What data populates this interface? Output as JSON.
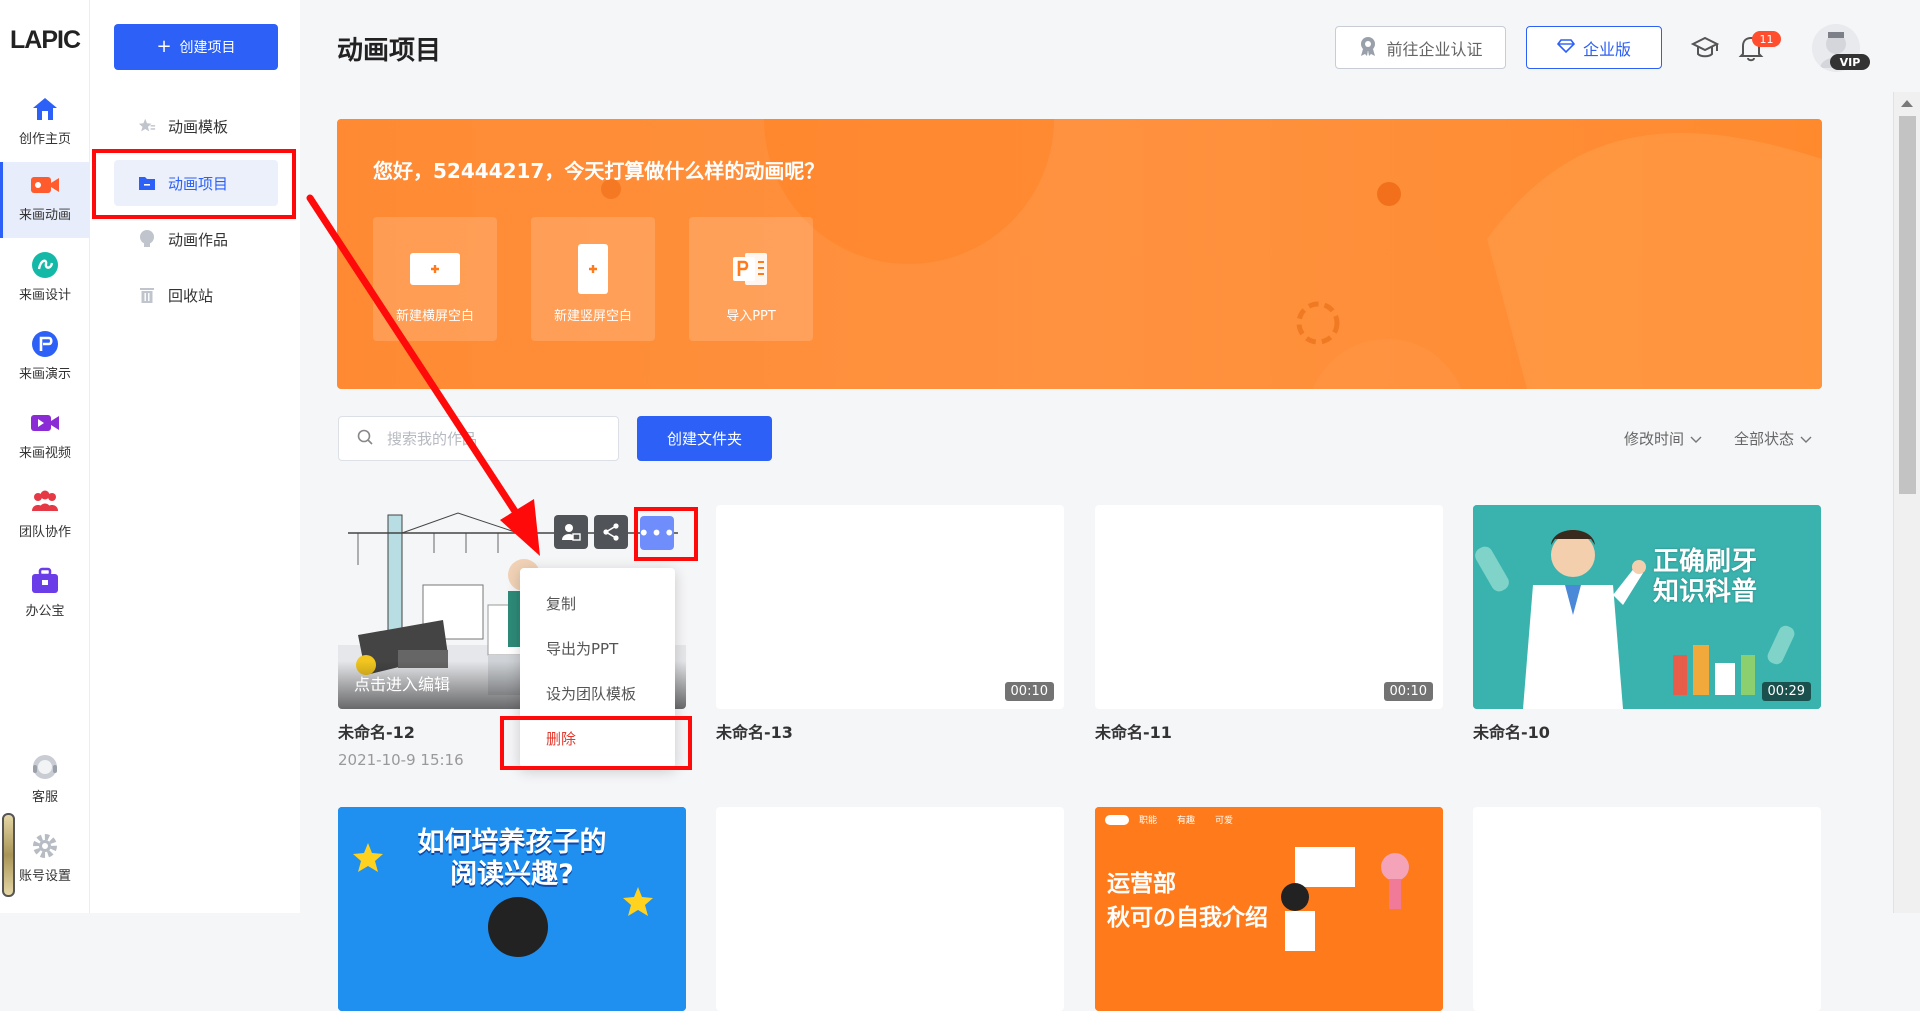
{
  "logo": "LAPIC",
  "rail": {
    "items": [
      {
        "label": "创作主页",
        "icon": "home-icon"
      },
      {
        "label": "来画动画",
        "icon": "video-camera-icon"
      },
      {
        "label": "来画设计",
        "icon": "design-icon"
      },
      {
        "label": "来画演示",
        "icon": "presentation-icon"
      },
      {
        "label": "来画视频",
        "icon": "video-icon"
      },
      {
        "label": "团队协作",
        "icon": "team-icon"
      },
      {
        "label": "办公宝",
        "icon": "briefcase-icon"
      }
    ],
    "bottom": [
      {
        "label": "客服",
        "icon": "headset-icon"
      },
      {
        "label": "账号设置",
        "icon": "gear-icon"
      }
    ]
  },
  "sidebar": {
    "create_label": "创建项目",
    "items": [
      {
        "label": "动画模板",
        "icon": "star-icon"
      },
      {
        "label": "动画项目",
        "icon": "folder-icon"
      },
      {
        "label": "动画作品",
        "icon": "bulb-icon"
      },
      {
        "label": "回收站",
        "icon": "trash-icon"
      }
    ]
  },
  "header": {
    "title": "动画项目",
    "cert_label": "前往企业认证",
    "enterprise_label": "企业版",
    "notification_count": "11",
    "vip_label": "VIP"
  },
  "banner": {
    "greeting": "您好，52444217，今天打算做什么样的动画呢？",
    "actions": [
      {
        "label": "新建横屏空白"
      },
      {
        "label": "新建竖屏空白"
      },
      {
        "label": "导入PPT"
      }
    ]
  },
  "toolbar": {
    "search_placeholder": "搜索我的作品",
    "create_folder_label": "创建文件夹",
    "sort_label": "修改时间",
    "status_label": "全部状态"
  },
  "projects": [
    {
      "title": "未命名-12",
      "date": "2021-10-9 15:16",
      "hover_text": "点击进入编辑"
    },
    {
      "title": "未命名-13",
      "duration": "00:10"
    },
    {
      "title": "未命名-11",
      "duration": "00:10"
    },
    {
      "title": "未命名-10",
      "duration": "00:29",
      "thumb_text_1": "正确刷牙",
      "thumb_text_2": "知识科普"
    }
  ],
  "projects_row2": [
    {
      "thumb_text_1": "如何培养孩子的",
      "thumb_text_2": "阅读兴趣?"
    },
    {},
    {
      "thumb_text_1": "运营部",
      "thumb_text_2": "秋可の自我介绍",
      "tags": [
        "职能",
        "有趣",
        "可爱"
      ]
    },
    {}
  ],
  "context_menu": {
    "items": [
      "复制",
      "导出为PPT",
      "设为团队模板",
      "删除"
    ]
  },
  "colors": {
    "primary": "#2c60f6",
    "banner": "#ff8a33",
    "danger": "#e23a2e",
    "annotation": "#ff0a0a"
  }
}
